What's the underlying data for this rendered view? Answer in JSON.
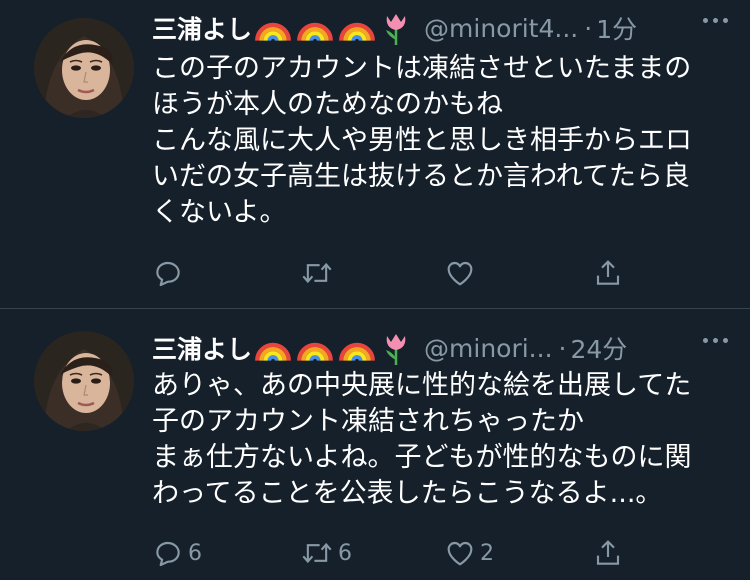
{
  "colors": {
    "background": "#15202b",
    "divider": "#38444d",
    "primary_text": "#ffffff",
    "secondary_text": "#8899a6"
  },
  "tweets": [
    {
      "display_name": "三浦よし",
      "name_emojis": [
        "rainbow-icon",
        "rainbow-icon",
        "rainbow-icon",
        "tulip-icon"
      ],
      "handle": "@minorit4...",
      "separator": "·",
      "time": "1分",
      "text_lines": [
        "この子のアカウントは凍結させといたままの",
        "ほうが本人のためなのかもね",
        "こんな風に大人や男性と思しき相手からエロ",
        "いだの女子高生は抜けるとか言われてたら良",
        "くないよ。"
      ],
      "actions": {
        "reply": {
          "icon": "reply-icon",
          "count": ""
        },
        "retweet": {
          "icon": "retweet-icon",
          "count": ""
        },
        "like": {
          "icon": "heart-icon",
          "count": ""
        },
        "share": {
          "icon": "share-icon",
          "count": ""
        }
      }
    },
    {
      "display_name": "三浦よし",
      "name_emojis": [
        "rainbow-icon",
        "rainbow-icon",
        "rainbow-icon",
        "tulip-icon"
      ],
      "handle": "@minori...",
      "separator": "·",
      "time": "24分",
      "text_lines": [
        "ありゃ、あの中央展に性的な絵を出展してた",
        "子のアカウント凍結されちゃったか",
        "まぁ仕方ないよね。子どもが性的なものに関",
        "わってることを公表したらこうなるよ...。"
      ],
      "actions": {
        "reply": {
          "icon": "reply-icon",
          "count": "6"
        },
        "retweet": {
          "icon": "retweet-icon",
          "count": "6"
        },
        "like": {
          "icon": "heart-icon",
          "count": "2"
        },
        "share": {
          "icon": "share-icon",
          "count": ""
        }
      }
    }
  ]
}
